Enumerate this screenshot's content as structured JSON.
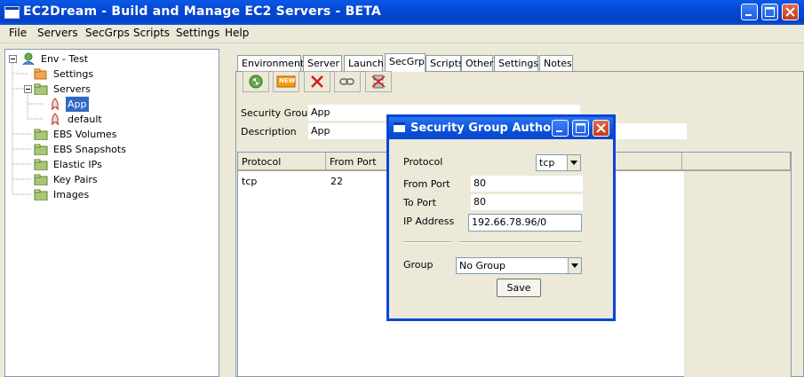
{
  "window": {
    "title": "EC2Dream - Build and Manage EC2 Servers - BETA"
  },
  "menubar": {
    "items": [
      "File",
      "Servers",
      "SecGrps",
      "Scripts",
      "Settings",
      "Help"
    ]
  },
  "tree": {
    "root": "Env - Test",
    "settings": "Settings",
    "servers": "Servers",
    "server_items": [
      "App",
      "default"
    ],
    "groups": [
      "EBS Volumes",
      "EBS Snapshots",
      "Elastic IPs",
      "Key Pairs",
      "Images"
    ]
  },
  "tabs": [
    "Environment",
    "Server",
    "Launch",
    "SecGrp",
    "Scripts",
    "Other",
    "Settings",
    "Notes"
  ],
  "active_tab": "SecGrp",
  "toolbar": {
    "buttons": [
      "refresh-icon",
      "new-icon",
      "delete-icon",
      "link-icon",
      "disconnect-icon"
    ],
    "new_badge": "NEW"
  },
  "secgrp": {
    "security_group_label": "Security Group",
    "security_group_value": "App",
    "description_label": "Description",
    "description_value": "App"
  },
  "table": {
    "columns": [
      "Protocol",
      "From Port"
    ],
    "rows": [
      {
        "protocol": "tcp",
        "from_port": "22"
      }
    ]
  },
  "dialog": {
    "title": "Security Group Author...",
    "protocol_label": "Protocol",
    "protocol_value": "tcp",
    "from_port_label": "From Port",
    "from_port_value": "80",
    "to_port_label": "To Port",
    "to_port_value": "80",
    "ip_label": "IP Address",
    "ip_value": "192.66.78.96/0",
    "group_label": "Group",
    "group_value": "No Group",
    "save_label": "Save"
  },
  "colors": {
    "titlebar": "#0548d6",
    "selection": "#316ac5",
    "close_button": "#c23a1c"
  }
}
